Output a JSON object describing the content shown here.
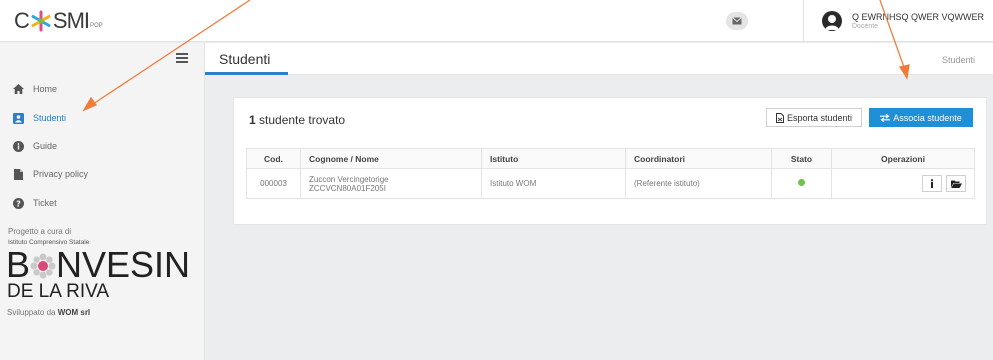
{
  "header": {
    "logo": {
      "c": "C",
      "smi": "SMI",
      "pop": "POP"
    },
    "user": {
      "name": "Q EWRNHSQ QWER VQWWER",
      "role": "Docente"
    }
  },
  "sidebar": {
    "items": [
      {
        "label": "Home",
        "icon": "home-icon"
      },
      {
        "label": "Studenti",
        "icon": "user-icon",
        "active": true
      },
      {
        "label": "Guide",
        "icon": "info-icon"
      },
      {
        "label": "Privacy policy",
        "icon": "file-icon"
      },
      {
        "label": "Ticket",
        "icon": "question-icon"
      }
    ],
    "credit_title": "Progetto a cura di",
    "credit_school": "Istituto Comprensivo Statale",
    "bonvesin_b": "B",
    "bonvesin_rest": "NVESIN",
    "dellariva": "DE LA RIVA",
    "dev_prefix": "Sviluppato da ",
    "dev_company": "WOM srl"
  },
  "page": {
    "title": "Studenti",
    "breadcrumb": "Studenti"
  },
  "card": {
    "count": "1",
    "count_label": " studente trovato",
    "export_label": "Esporta studenti",
    "associate_label": "Associa studente"
  },
  "table": {
    "headers": [
      "Cod.",
      "Cognome / Nome",
      "Istituto",
      "Coordinatori",
      "Stato",
      "Operazioni"
    ],
    "rows": [
      {
        "code": "000003",
        "name": "Zuccon Vercingetorige",
        "tax_code": "ZCCVCN80A01F205I",
        "institute": "Istituto WOM",
        "coordinators": "(Referente istituto)",
        "status_color": "#6cc24a"
      }
    ]
  },
  "colors": {
    "accent": "#2b7ec9",
    "primary_button": "#1f8fd8",
    "annotation_arrow": "#f07c3c"
  }
}
